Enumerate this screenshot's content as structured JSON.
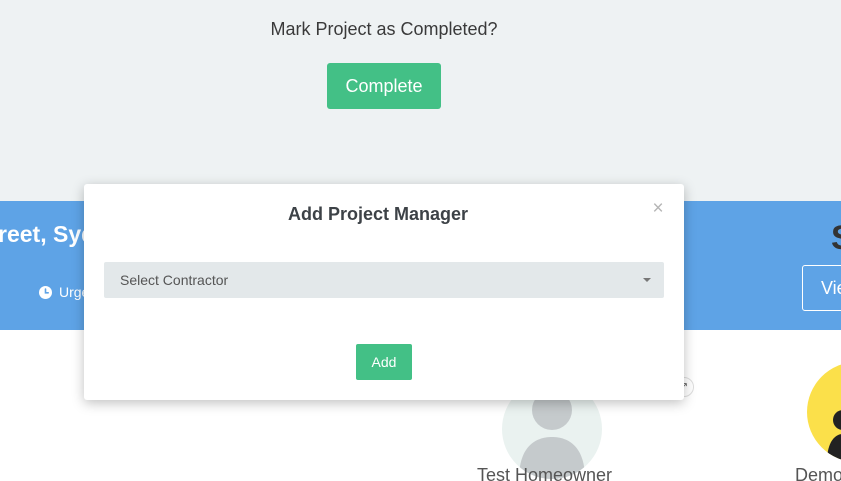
{
  "complete_section": {
    "question": "Mark Project as Completed?",
    "button_label": "Complete"
  },
  "banner": {
    "address_fragment": "reet, Syd",
    "urgency_fragment": "Urge",
    "status_fragment": "S",
    "view_button_fragment": "Vie"
  },
  "people": {
    "homeowner_name": "Test Homeowner",
    "demo_name_fragment": "Demo"
  },
  "modal": {
    "title": "Add Project Manager",
    "close_symbol": "×",
    "select_label": "Select Contractor",
    "add_button_label": "Add"
  },
  "colors": {
    "accent_green": "#43c086",
    "banner_blue": "#5ea3e6",
    "page_bg": "#eef2f3"
  },
  "icons": {
    "clock": "clock-icon",
    "close": "close-icon",
    "caret": "chevron-down-icon",
    "edit": "edit-icon",
    "person": "person-icon"
  }
}
